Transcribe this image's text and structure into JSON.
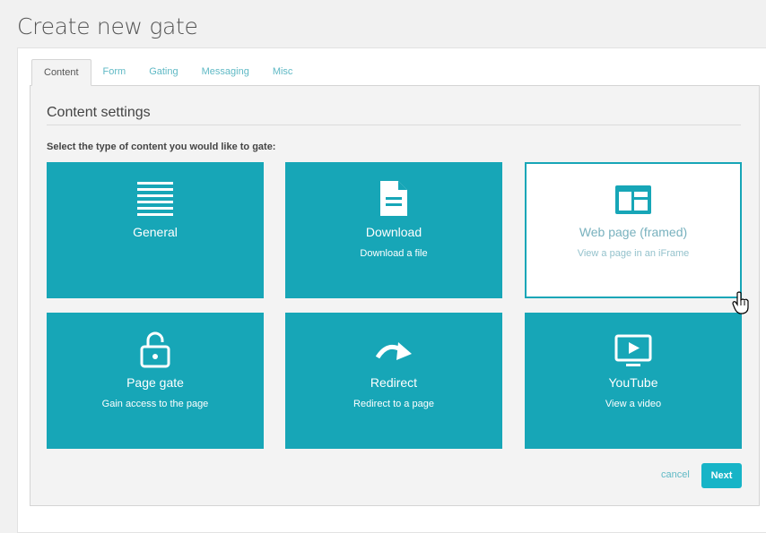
{
  "page": {
    "title": "Create new gate"
  },
  "tabs": [
    {
      "label": "Content",
      "active": true
    },
    {
      "label": "Form",
      "active": false
    },
    {
      "label": "Gating",
      "active": false
    },
    {
      "label": "Messaging",
      "active": false
    },
    {
      "label": "Misc",
      "active": false
    }
  ],
  "content": {
    "section_title": "Content settings",
    "prompt": "Select the type of content you would like to gate:",
    "cards": [
      {
        "title": "General",
        "subtitle": "",
        "icon": "list-lines-icon",
        "selected": false
      },
      {
        "title": "Download",
        "subtitle": "Download a file",
        "icon": "document-icon",
        "selected": false
      },
      {
        "title": "Web page (framed)",
        "subtitle": "View a page in an iFrame",
        "icon": "browser-window-icon",
        "selected": true
      },
      {
        "title": "Page gate",
        "subtitle": "Gain access to the page",
        "icon": "unlock-icon",
        "selected": false
      },
      {
        "title": "Redirect",
        "subtitle": "Redirect to a page",
        "icon": "redirect-arrow-icon",
        "selected": false
      },
      {
        "title": "YouTube",
        "subtitle": "View a video",
        "icon": "video-play-icon",
        "selected": false
      }
    ]
  },
  "actions": {
    "cancel_label": "cancel",
    "next_label": "Next"
  },
  "colors": {
    "accent": "#17a6b7",
    "link": "#5fb9c5",
    "background": "#f1f1f1"
  }
}
